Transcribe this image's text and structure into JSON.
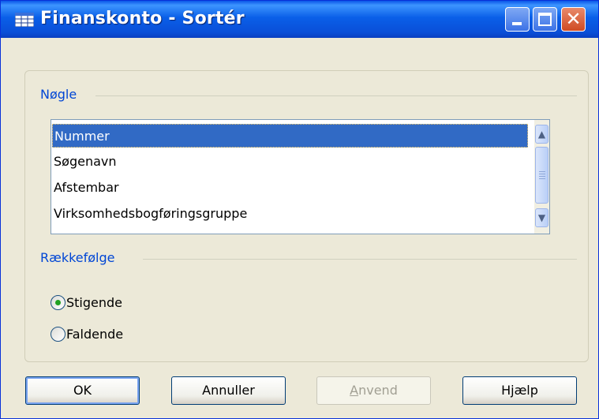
{
  "window": {
    "title": "Finanskonto - Sortér"
  },
  "titlebar": {
    "minimize_icon": "minimize-icon",
    "maximize_icon": "maximize-icon",
    "close_icon": "close-icon",
    "close_glyph": "✕",
    "app_icon": "table-icon"
  },
  "key_group": {
    "label": "Nøgle",
    "items": [
      "Nummer",
      "Søgenavn",
      "Afstembar",
      "Virksomhedsbogføringsgruppe"
    ],
    "selected_index": 0,
    "scroll_up_glyph": "▲",
    "scroll_down_glyph": "▼"
  },
  "order_group": {
    "label": "Rækkefølge",
    "options": [
      "Stigende",
      "Faldende"
    ],
    "selected_index": 0
  },
  "buttons": {
    "ok": "OK",
    "cancel": "Annuller",
    "apply_underlined": "A",
    "apply_rest": "nvend",
    "help": "Hjælp"
  },
  "colors": {
    "titlebar": "#0a5fe8",
    "dialog_bg": "#ece9d8",
    "selection": "#316ac5",
    "group_label": "#0046d5"
  }
}
